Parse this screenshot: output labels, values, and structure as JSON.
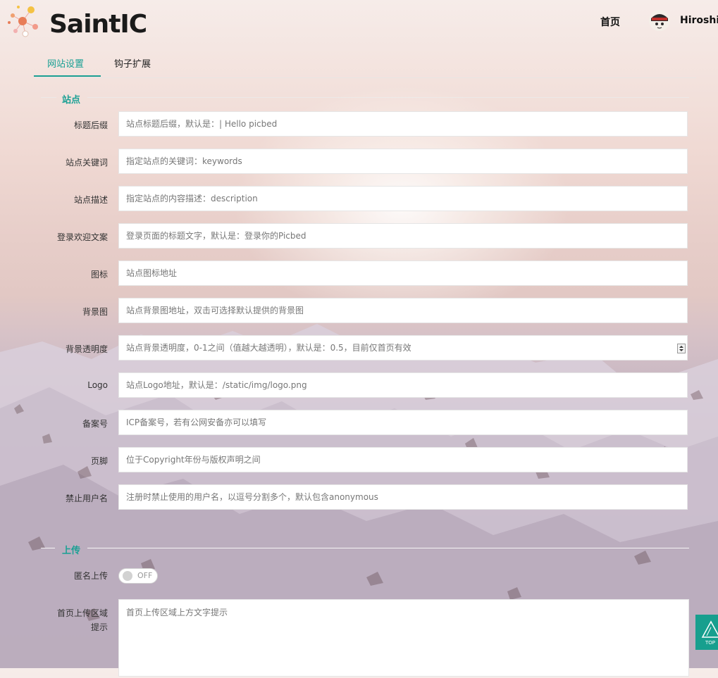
{
  "brand": {
    "name": "SaintIC"
  },
  "header": {
    "nav_home": "首页",
    "username": "Hiroshi"
  },
  "tabs": [
    {
      "label": "网站设置",
      "active": true
    },
    {
      "label": "钩子扩展",
      "active": false
    }
  ],
  "sections": {
    "site": "站点",
    "upload": "上传"
  },
  "fields": [
    {
      "label": "标题后缀",
      "placeholder": "站点标题后缀，默认是：| Hello picbed"
    },
    {
      "label": "站点关键词",
      "placeholder": "指定站点的关键词：keywords"
    },
    {
      "label": "站点描述",
      "placeholder": "指定站点的内容描述：description"
    },
    {
      "label": "登录欢迎文案",
      "placeholder": "登录页面的标题文字，默认是：登录你的Picbed"
    },
    {
      "label": "图标",
      "placeholder": "站点图标地址"
    },
    {
      "label": "背景图",
      "placeholder": "站点背景图地址，双击可选择默认提供的背景图"
    },
    {
      "label": "背景透明度",
      "placeholder": "站点背景透明度，0-1之间（值越大越透明），默认是：0.5，目前仅首页有效"
    },
    {
      "label": "Logo",
      "placeholder": "站点Logo地址，默认是：/static/img/logo.png"
    },
    {
      "label": "备案号",
      "placeholder": "ICP备案号，若有公网安备亦可以填写"
    },
    {
      "label": "页脚",
      "placeholder": "位于Copyright年份与版权声明之间"
    },
    {
      "label": "禁止用户名",
      "placeholder": "注册时禁止使用的用户名，以逗号分割多个，默认包含anonymous"
    }
  ],
  "upload": {
    "anonymous_label": "匿名上传",
    "anonymous_state": "OFF",
    "tip_label_line1": "首页上传区域",
    "tip_label_line2": "提示",
    "tip_placeholder": "首页上传区域上方文字提示"
  },
  "top_button": {
    "label": "TOP"
  },
  "colors": {
    "accent": "#1aa094",
    "top_button": "#179f8e"
  },
  "icons": {
    "logo": "molecule-logo-icon",
    "avatar": "avatar-icon",
    "back_to_top": "back-to-top-icon"
  }
}
